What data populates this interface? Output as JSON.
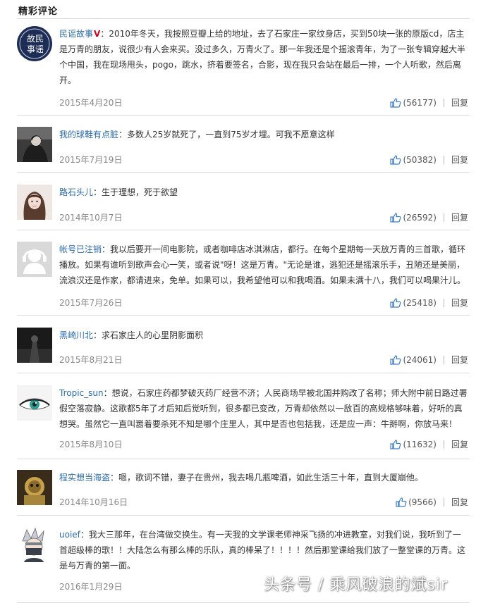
{
  "header": {
    "title": "精彩评论"
  },
  "comments": [
    {
      "user": "民谣故事",
      "verified": "V",
      "text": "2010年冬天，我按照豆瓣上给的地址，去了石家庄一家纹身店，买到50块一张的原版cd，店主是万青的朋友，说很少有人会来买。没过多久，万青火了。那一年我还是个摇滚青年，为了一张专辑穿越大半个中国，我在现场甩头，pogo，跳水，挤着要签名，合影，现在我只会站在最后一排，一个人听歌，然后离开。",
      "date": "2015年4月20日",
      "likes": "(56177)",
      "reply": "回复"
    },
    {
      "user": "我的球鞋有点脏",
      "text": "多数人25岁就死了，一直到75岁才埋。可我不愿意这样",
      "date": "2015年7月19日",
      "likes": "(50382)",
      "reply": "回复"
    },
    {
      "user": "路石头儿",
      "text": "生于理想，死于欲望",
      "date": "2014年10月7日",
      "likes": "(26592)",
      "reply": "回复"
    },
    {
      "user": "帐号已注销",
      "text": "我以后要开一间电影院，或者咖啡店冰淇淋店，都行。在每个星期每一天放万青的三首歌，循环播放。如果有谁听到歌声会心一笑，或者说\"呀！这是万青。\"无论是谁，逃犯还是摇滚乐手，丑陋还是美丽，流浪汉还是作家，都请进来，免单。如果可以，我希望他可以和我喝酒。如果未满十八，我们可以喝果汁儿。",
      "date": "2015年7月26日",
      "likes": "(25418)",
      "reply": "回复"
    },
    {
      "user": "黑崎川北",
      "text": "求石家庄人的心里阴影面积",
      "date": "2015年8月21日",
      "likes": "(24061)",
      "reply": "回复"
    },
    {
      "user": "Tropic_sun",
      "text": "想说，石家庄药都梦破灭药厂经营不济；人民商场早被北国并购改了名称；师大附中前日路过署假空落寂静。这歌都5年了才后知后觉听到，很多都已变改，万青却依然以一敌百的高规格够味着，好听的真想哭。虽然它一直叫嚣着要杀死不知是哪个庄里人，其中是否也包括我，还是应一声：牛掰啊，你放马来！",
      "date": "2015年8月10日",
      "likes": "(11632)",
      "reply": "回复"
    },
    {
      "user": "程实想当海盗",
      "text": "嗯，歌词不错，妻子在贵州，我去喝几瓶啤酒，如此生活三十年，直到大厦崩他。",
      "date": "2014年10月16日",
      "likes": "(9566)",
      "reply": "回复"
    },
    {
      "user": "uoief",
      "text": "我大三那年，在台湾做交换生。有一天我的文学课老师神采飞扬的冲进教室，对我们说，我听到了一首超级棒的歌！！大陆怎么有那么棒的乐队，真的棒呆了！！！！然后那堂课给我们放了一整堂课的万青。这是与万青的第一面。",
      "date": "2016年1月29日"
    }
  ],
  "watermark": "头条号 / 乘风破浪的斌sir"
}
